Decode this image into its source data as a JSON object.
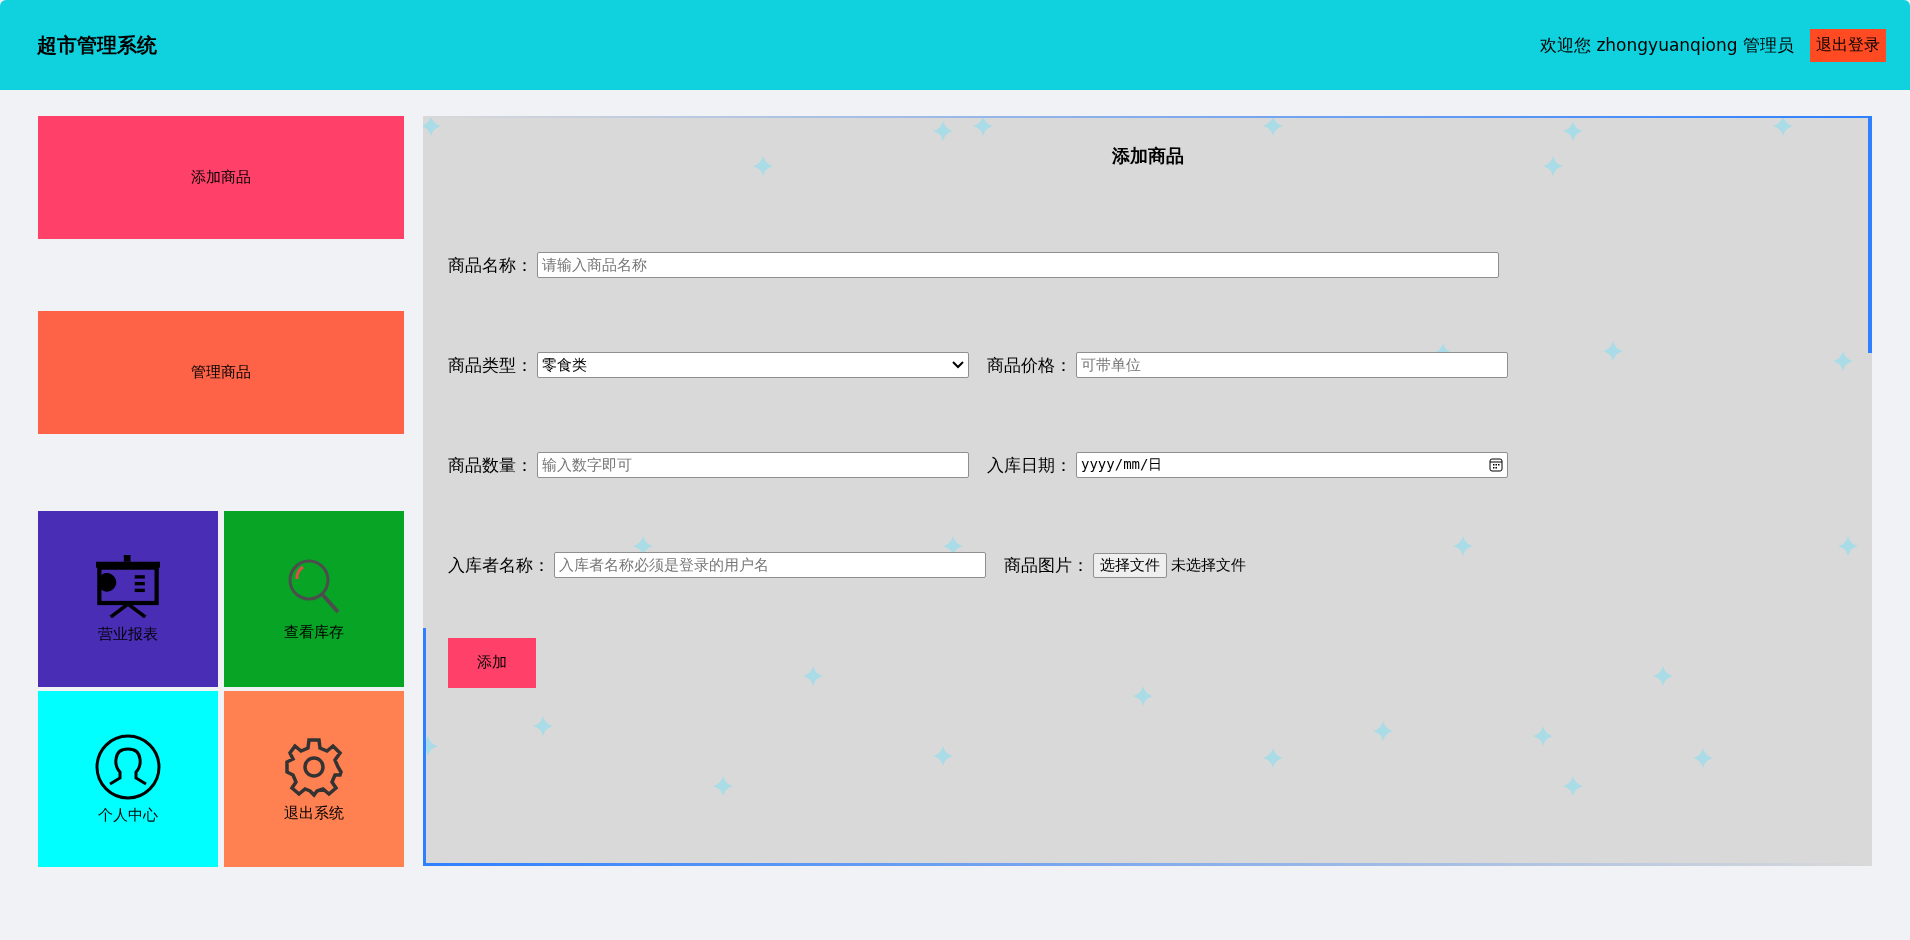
{
  "header": {
    "title": "超市管理系统",
    "welcome": "欢迎您 zhongyuanqiong 管理员",
    "logout": "退出登录"
  },
  "sidebar": {
    "menu": [
      {
        "label": "添加商品",
        "color": "#ff4169"
      },
      {
        "label": "管理商品",
        "color": "#ff6347"
      }
    ],
    "tiles": [
      {
        "label": "营业报表",
        "kind": "report",
        "color": "#4a2db5"
      },
      {
        "label": "查看库存",
        "kind": "search",
        "color": "#07a426"
      },
      {
        "label": "个人中心",
        "kind": "user",
        "color": "#00ffff"
      },
      {
        "label": "退出系统",
        "kind": "settings",
        "color": "#ff8050"
      }
    ]
  },
  "form": {
    "title": "添加商品",
    "rows": [
      [
        {
          "label": "商品名称：",
          "kind": "text",
          "placeholder": "请输入商品名称"
        }
      ],
      [
        {
          "label": "商品类型：",
          "kind": "select",
          "value": "零食类"
        },
        {
          "label": "商品价格：",
          "kind": "text",
          "placeholder": "可带单位"
        }
      ],
      [
        {
          "label": "商品数量：",
          "kind": "text",
          "placeholder": "输入数字即可"
        },
        {
          "label": "入库日期：",
          "kind": "date",
          "placeholder": "yyyy/mm/日"
        }
      ],
      [
        {
          "label": "入库者名称：",
          "kind": "text",
          "placeholder": "入库者名称必须是登录的用户名"
        },
        {
          "label": "商品图片：",
          "kind": "file",
          "button": "选择文件",
          "status": "未选择文件"
        }
      ]
    ],
    "submit": "添加"
  }
}
